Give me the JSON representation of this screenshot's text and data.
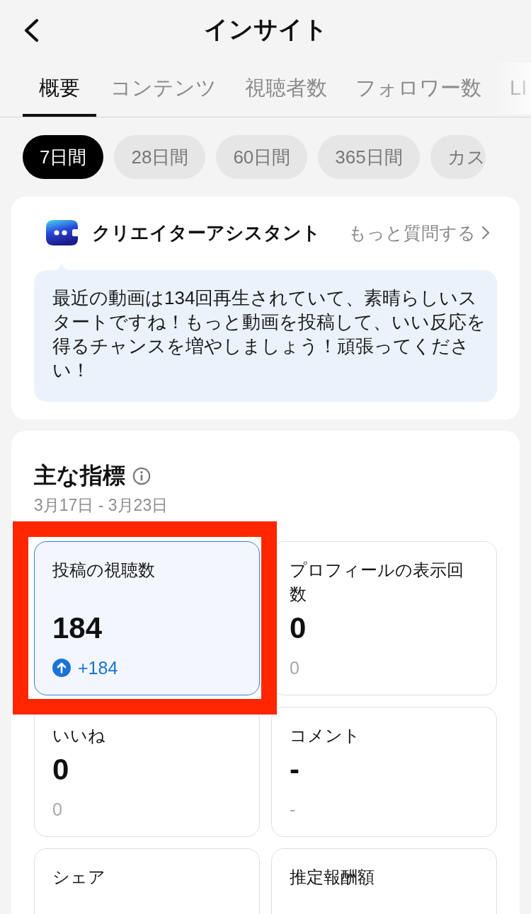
{
  "header": {
    "title": "インサイト"
  },
  "tabs": [
    {
      "label": "概要",
      "selected": true
    },
    {
      "label": "コンテンツ",
      "selected": false
    },
    {
      "label": "視聴者数",
      "selected": false
    },
    {
      "label": "フォロワー数",
      "selected": false
    },
    {
      "label": "LI",
      "selected": false
    }
  ],
  "periods": [
    {
      "label": "7日間",
      "selected": true
    },
    {
      "label": "28日間",
      "selected": false
    },
    {
      "label": "60日間",
      "selected": false
    },
    {
      "label": "365日間",
      "selected": false
    },
    {
      "label": "カス",
      "selected": false
    }
  ],
  "assistant": {
    "title": "クリエイターアシスタント",
    "link": "もっと質問する",
    "message": "最近の動画は134回再生されていて、素晴らしいスタートですね！もっと動画を投稿して、いい反応を得るチャンスを増やしましょう！頑張ってください！"
  },
  "key_metrics": {
    "title": "主な指標",
    "date_range": "3月17日 - 3月23日",
    "metrics": [
      {
        "kind": "increase",
        "label": "投稿の視聴数",
        "value": "184",
        "change": "+184",
        "selected": true,
        "highlighted": true
      },
      {
        "kind": "neutral",
        "label": "プロフィールの表示回数",
        "value": "0",
        "change": "0",
        "selected": false,
        "highlighted": false
      },
      {
        "kind": "neutral",
        "label": "いいね",
        "value": "0",
        "change": "0",
        "selected": false,
        "highlighted": false
      },
      {
        "kind": "neutral",
        "label": "コメント",
        "value": "-",
        "change": "-",
        "selected": false,
        "highlighted": false
      },
      {
        "kind": "neutral",
        "label": "シェア",
        "selected": false,
        "highlighted": false
      },
      {
        "kind": "neutral",
        "label": "推定報酬額",
        "selected": false,
        "highlighted": false
      }
    ]
  }
}
